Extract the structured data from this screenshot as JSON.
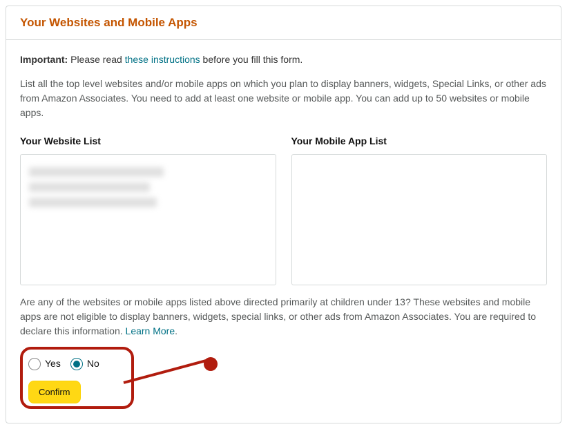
{
  "header": {
    "title": "Your Websites and Mobile Apps"
  },
  "intro": {
    "important_label": "Important:",
    "prefix": " Please read ",
    "link_text": "these instructions",
    "suffix": " before you fill this form."
  },
  "description": "List all the top level websites and/or mobile apps on which you plan to display banners, widgets, Special Links, or other ads from Amazon Associates. You need to add at least one website or mobile app. You can add up to 50 websites or mobile apps.",
  "lists": {
    "website": {
      "title": "Your Website List"
    },
    "mobile": {
      "title": "Your Mobile App List"
    }
  },
  "question": {
    "text": "Are any of the websites or mobile apps listed above directed primarily at children under 13? These websites and mobile apps are not eligible to display banners, widgets, special links, or other ads from Amazon Associates. You are required to declare this information. ",
    "learn_more": "Learn More",
    "period": "."
  },
  "radios": {
    "yes": "Yes",
    "no": "No",
    "selected": "no"
  },
  "confirm": {
    "label": "Confirm"
  }
}
